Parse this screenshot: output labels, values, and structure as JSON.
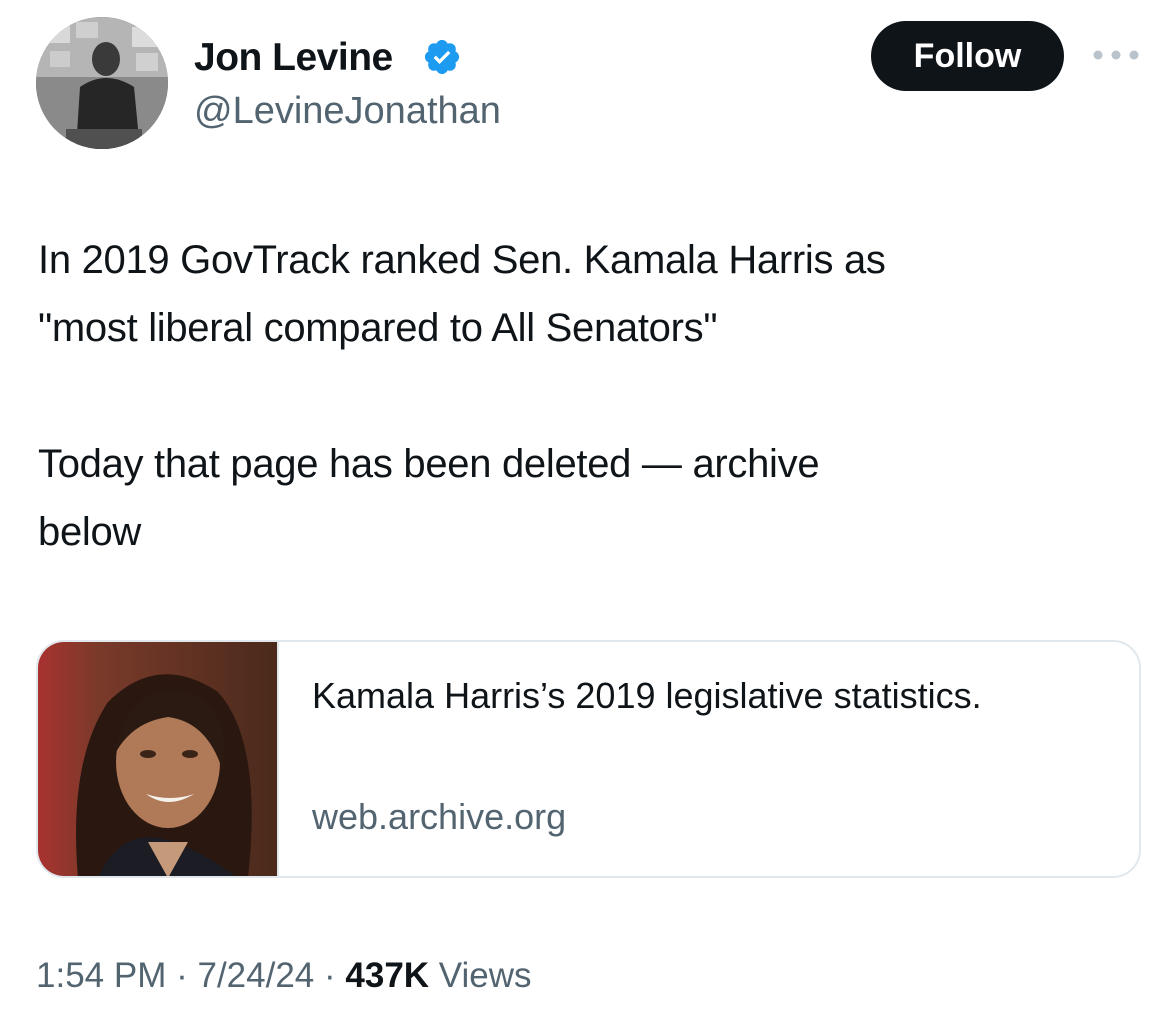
{
  "author": {
    "name": "Jon Levine",
    "handle": "@LevineJonathan",
    "verified": true,
    "verified_color": "#1d9bf0"
  },
  "actions": {
    "follow_label": "Follow",
    "more_icon": "more-horizontal-icon"
  },
  "tweet": {
    "text": "In 2019 GovTrack ranked Sen. Kamala Harris as\n\"most liberal compared to All Senators\"\n\nToday that page has been deleted — archive\nbelow"
  },
  "link_card": {
    "title": "Kamala Harris’s 2019 legislative statistics.",
    "domain": "web.archive.org"
  },
  "meta": {
    "time": "1:54 PM",
    "separator": "·",
    "date": "7/24/24",
    "views_count": "437K",
    "views_label": "Views"
  },
  "colors": {
    "text_primary": "#0f1419",
    "text_secondary": "#536471",
    "button_bg": "#0f1419",
    "border": "#e1e8ed"
  }
}
